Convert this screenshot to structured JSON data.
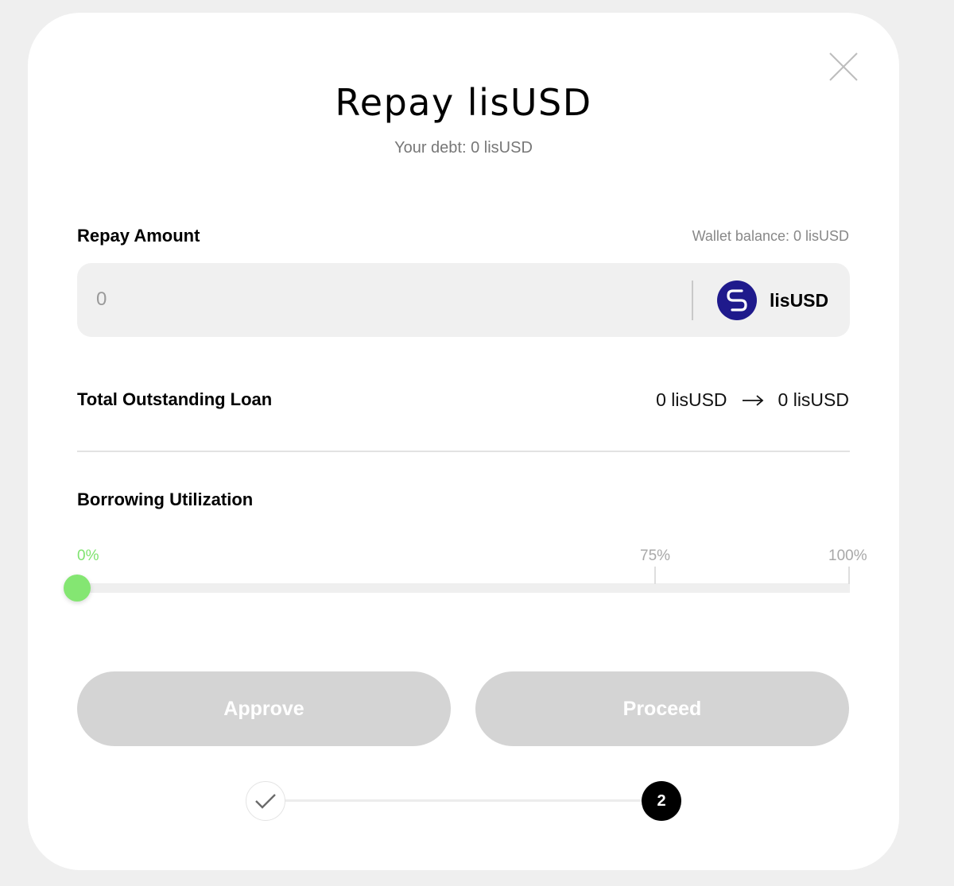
{
  "modal": {
    "title": "Repay lisUSD",
    "debt_text": "Your debt: 0 lisUSD"
  },
  "repay": {
    "label": "Repay Amount",
    "wallet_balance": "Wallet balance: 0 lisUSD",
    "input_placeholder": "0",
    "input_value": "",
    "token_name": "lisUSD",
    "token_icon": "lisusd-token-icon"
  },
  "loan": {
    "label": "Total Outstanding Loan",
    "current": "0 lisUSD",
    "after": "0 lisUSD"
  },
  "utilization": {
    "label": "Borrowing Utilization",
    "marks": {
      "zero": "0%",
      "mid": "75%",
      "max": "100%"
    },
    "value_percent": 0
  },
  "actions": {
    "approve_label": "Approve",
    "proceed_label": "Proceed"
  },
  "steps": {
    "step1_state": "completed",
    "step2_label": "2"
  },
  "colors": {
    "accent_green": "#84e672",
    "token_blue": "#1f1a8c",
    "button_disabled": "#d4d4d4"
  }
}
